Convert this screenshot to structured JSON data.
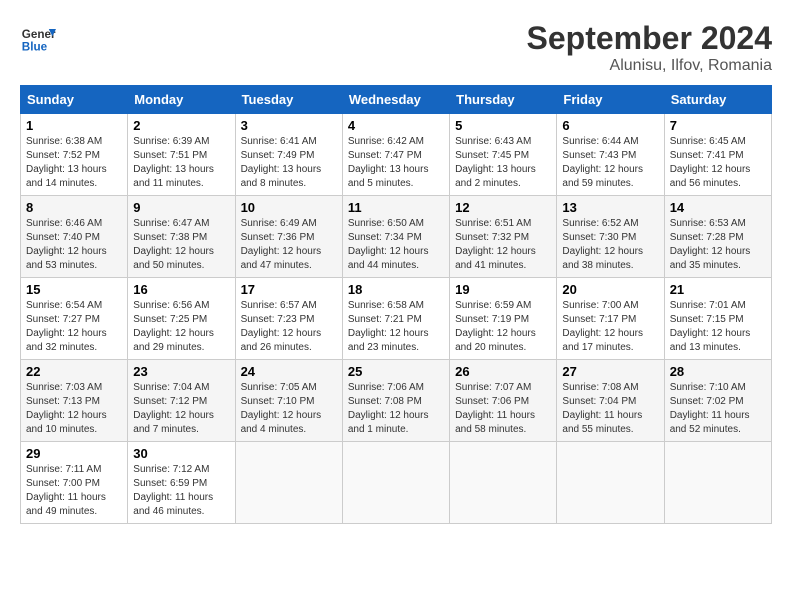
{
  "header": {
    "logo_line1": "General",
    "logo_line2": "Blue",
    "month_year": "September 2024",
    "location": "Alunisu, Ilfov, Romania"
  },
  "days_of_week": [
    "Sunday",
    "Monday",
    "Tuesday",
    "Wednesday",
    "Thursday",
    "Friday",
    "Saturday"
  ],
  "weeks": [
    [
      {
        "day": "1",
        "sunrise": "6:38 AM",
        "sunset": "7:52 PM",
        "daylight": "13 hours and 14 minutes."
      },
      {
        "day": "2",
        "sunrise": "6:39 AM",
        "sunset": "7:51 PM",
        "daylight": "13 hours and 11 minutes."
      },
      {
        "day": "3",
        "sunrise": "6:41 AM",
        "sunset": "7:49 PM",
        "daylight": "13 hours and 8 minutes."
      },
      {
        "day": "4",
        "sunrise": "6:42 AM",
        "sunset": "7:47 PM",
        "daylight": "13 hours and 5 minutes."
      },
      {
        "day": "5",
        "sunrise": "6:43 AM",
        "sunset": "7:45 PM",
        "daylight": "13 hours and 2 minutes."
      },
      {
        "day": "6",
        "sunrise": "6:44 AM",
        "sunset": "7:43 PM",
        "daylight": "12 hours and 59 minutes."
      },
      {
        "day": "7",
        "sunrise": "6:45 AM",
        "sunset": "7:41 PM",
        "daylight": "12 hours and 56 minutes."
      }
    ],
    [
      {
        "day": "8",
        "sunrise": "6:46 AM",
        "sunset": "7:40 PM",
        "daylight": "12 hours and 53 minutes."
      },
      {
        "day": "9",
        "sunrise": "6:47 AM",
        "sunset": "7:38 PM",
        "daylight": "12 hours and 50 minutes."
      },
      {
        "day": "10",
        "sunrise": "6:49 AM",
        "sunset": "7:36 PM",
        "daylight": "12 hours and 47 minutes."
      },
      {
        "day": "11",
        "sunrise": "6:50 AM",
        "sunset": "7:34 PM",
        "daylight": "12 hours and 44 minutes."
      },
      {
        "day": "12",
        "sunrise": "6:51 AM",
        "sunset": "7:32 PM",
        "daylight": "12 hours and 41 minutes."
      },
      {
        "day": "13",
        "sunrise": "6:52 AM",
        "sunset": "7:30 PM",
        "daylight": "12 hours and 38 minutes."
      },
      {
        "day": "14",
        "sunrise": "6:53 AM",
        "sunset": "7:28 PM",
        "daylight": "12 hours and 35 minutes."
      }
    ],
    [
      {
        "day": "15",
        "sunrise": "6:54 AM",
        "sunset": "7:27 PM",
        "daylight": "12 hours and 32 minutes."
      },
      {
        "day": "16",
        "sunrise": "6:56 AM",
        "sunset": "7:25 PM",
        "daylight": "12 hours and 29 minutes."
      },
      {
        "day": "17",
        "sunrise": "6:57 AM",
        "sunset": "7:23 PM",
        "daylight": "12 hours and 26 minutes."
      },
      {
        "day": "18",
        "sunrise": "6:58 AM",
        "sunset": "7:21 PM",
        "daylight": "12 hours and 23 minutes."
      },
      {
        "day": "19",
        "sunrise": "6:59 AM",
        "sunset": "7:19 PM",
        "daylight": "12 hours and 20 minutes."
      },
      {
        "day": "20",
        "sunrise": "7:00 AM",
        "sunset": "7:17 PM",
        "daylight": "12 hours and 17 minutes."
      },
      {
        "day": "21",
        "sunrise": "7:01 AM",
        "sunset": "7:15 PM",
        "daylight": "12 hours and 13 minutes."
      }
    ],
    [
      {
        "day": "22",
        "sunrise": "7:03 AM",
        "sunset": "7:13 PM",
        "daylight": "12 hours and 10 minutes."
      },
      {
        "day": "23",
        "sunrise": "7:04 AM",
        "sunset": "7:12 PM",
        "daylight": "12 hours and 7 minutes."
      },
      {
        "day": "24",
        "sunrise": "7:05 AM",
        "sunset": "7:10 PM",
        "daylight": "12 hours and 4 minutes."
      },
      {
        "day": "25",
        "sunrise": "7:06 AM",
        "sunset": "7:08 PM",
        "daylight": "12 hours and 1 minute."
      },
      {
        "day": "26",
        "sunrise": "7:07 AM",
        "sunset": "7:06 PM",
        "daylight": "11 hours and 58 minutes."
      },
      {
        "day": "27",
        "sunrise": "7:08 AM",
        "sunset": "7:04 PM",
        "daylight": "11 hours and 55 minutes."
      },
      {
        "day": "28",
        "sunrise": "7:10 AM",
        "sunset": "7:02 PM",
        "daylight": "11 hours and 52 minutes."
      }
    ],
    [
      {
        "day": "29",
        "sunrise": "7:11 AM",
        "sunset": "7:00 PM",
        "daylight": "11 hours and 49 minutes."
      },
      {
        "day": "30",
        "sunrise": "7:12 AM",
        "sunset": "6:59 PM",
        "daylight": "11 hours and 46 minutes."
      },
      null,
      null,
      null,
      null,
      null
    ]
  ]
}
